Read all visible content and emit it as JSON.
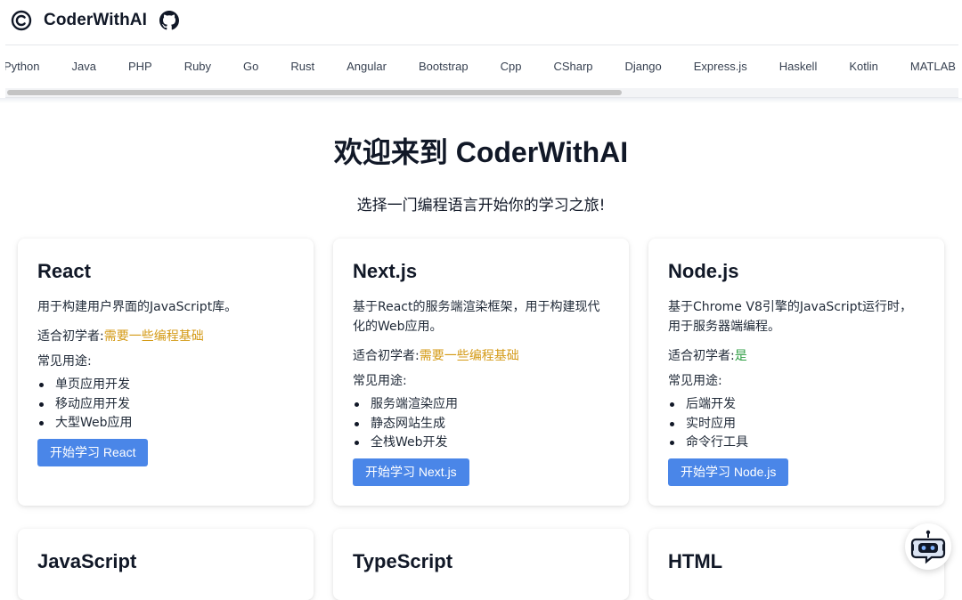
{
  "header": {
    "brand": "CoderWithAI",
    "logo_icon": "copyright-c-icon",
    "github_icon": "github-icon"
  },
  "languages": [
    "Python",
    "Java",
    "PHP",
    "Ruby",
    "Go",
    "Rust",
    "Angular",
    "Bootstrap",
    "Cpp",
    "CSharp",
    "Django",
    "Express.js",
    "Haskell",
    "Kotlin",
    "MATLAB"
  ],
  "hero": {
    "title": "欢迎来到 CoderWithAI",
    "subtitle": "选择一门编程语言开始你的学习之旅!"
  },
  "labels": {
    "level": "适合初学者:",
    "uses": "常见用途:"
  },
  "cards": [
    {
      "title": "React",
      "description": "用于构建用户界面的JavaScript库。",
      "level": "需要一些编程基础",
      "level_color": "#d49a16",
      "uses": [
        "单页应用开发",
        "移动应用开发",
        "大型Web应用"
      ],
      "button": "开始学习 React"
    },
    {
      "title": "Next.js",
      "description": "基于React的服务端渲染框架，用于构建现代化的Web应用。",
      "level": "需要一些编程基础",
      "level_color": "#d49a16",
      "uses": [
        "服务端渲染应用",
        "静态网站生成",
        "全栈Web开发"
      ],
      "button": "开始学习 Next.js"
    },
    {
      "title": "Node.js",
      "description": "基于Chrome V8引擎的JavaScript运行时，用于服务器端编程。",
      "level": "是",
      "level_color": "#2f9e44",
      "uses": [
        "后端开发",
        "实时应用",
        "命令行工具"
      ],
      "button": "开始学习 Node.js"
    },
    {
      "title": "JavaScript"
    },
    {
      "title": "TypeScript"
    },
    {
      "title": "HTML"
    }
  ],
  "chatbot_icon": "robot-chat-icon",
  "accent_color": "#4a86e8"
}
